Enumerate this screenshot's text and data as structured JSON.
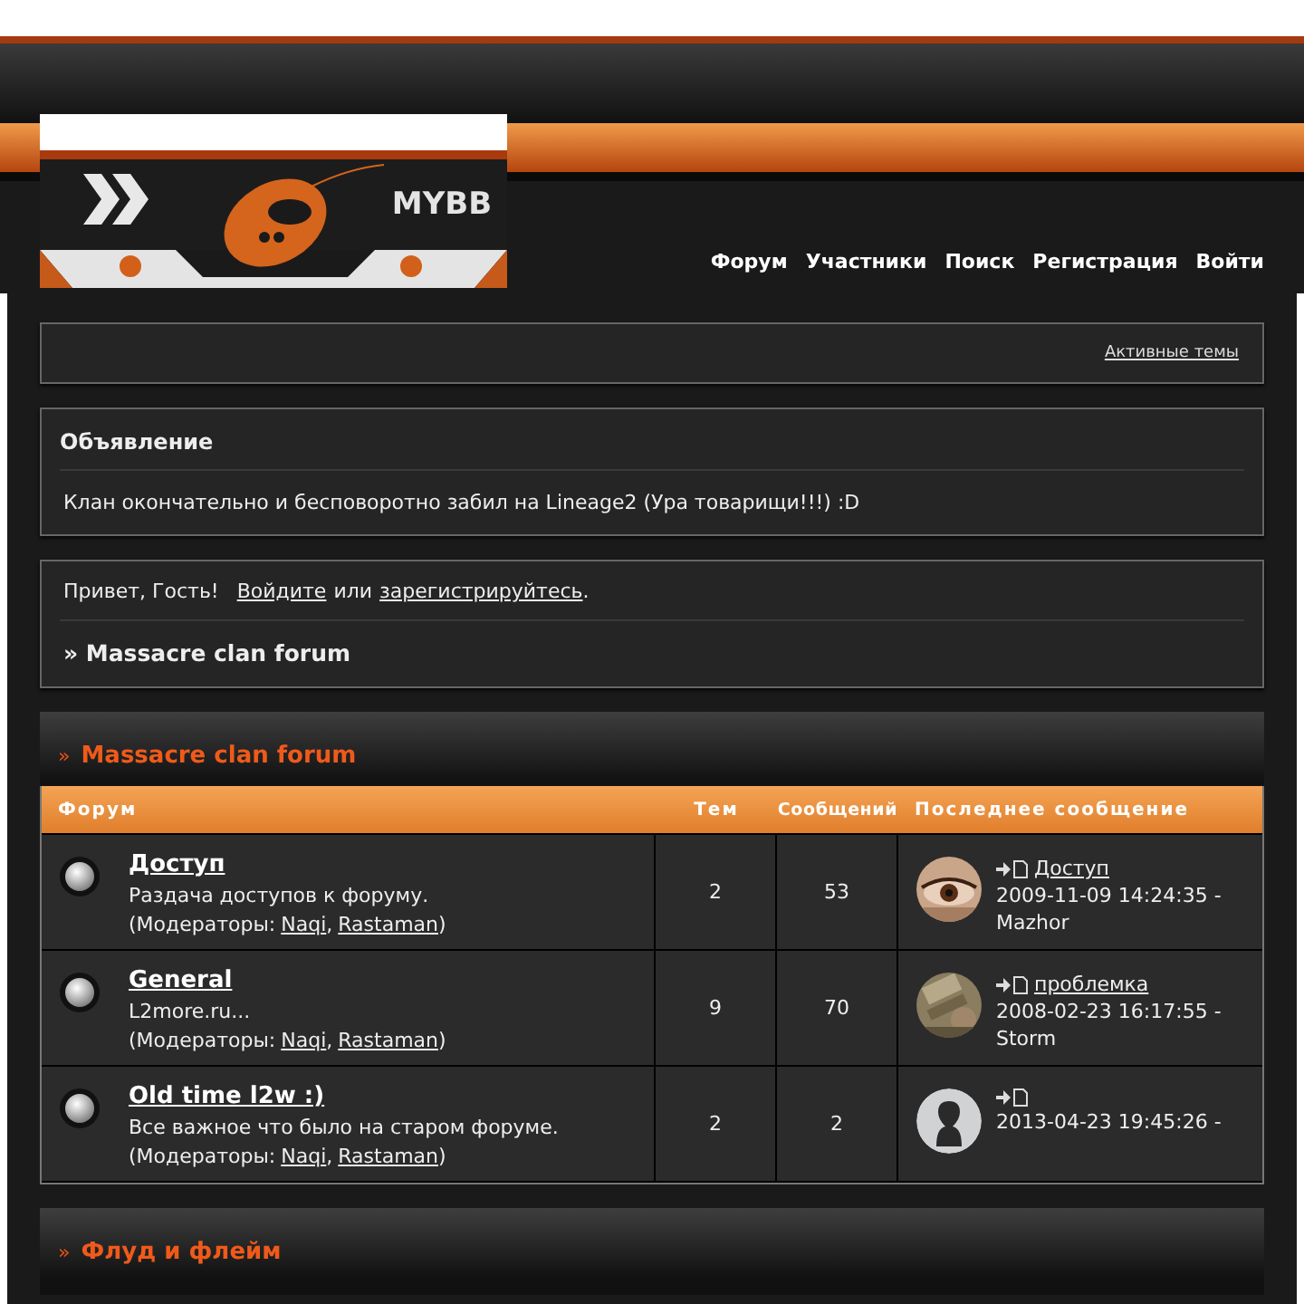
{
  "logo": {
    "text": "MYBB"
  },
  "nav": [
    "Форум",
    "Участники",
    "Поиск",
    "Регистрация",
    "Войти"
  ],
  "active_topics": "Активные темы",
  "announcement": {
    "title": "Объявление",
    "text": "Клан окончательно и бесповоротно забил на Lineage2 (Ура товарищи!!!) :D"
  },
  "welcome": {
    "greeting": "Привет, Гость!",
    "login": "Войдите",
    "or": "или",
    "register": "зарегистрируйтесь",
    "end": ".",
    "crumb": "» Massacre clan forum"
  },
  "categories": [
    {
      "marker": "»",
      "title": "Massacre clan forum",
      "columns": [
        "Форум",
        "Тем",
        "Сообщений",
        "Последнее сообщение"
      ],
      "rows": [
        {
          "name": "Доступ",
          "description": "Раздача доступов к форуму.",
          "moderators_label": "(Модераторы:",
          "moderators": [
            {
              "name": "Naqi",
              "after": ","
            },
            {
              "name": "Rastaman",
              "after": ")"
            }
          ],
          "topics": "2",
          "posts": "53",
          "last": {
            "kind": "picture",
            "title": "Доступ",
            "date": "2009-11-09 14:24:35 -",
            "author": "Mazhor"
          }
        },
        {
          "name": "General",
          "description": "L2more.ru...",
          "moderators_label": "(Модераторы:",
          "moderators": [
            {
              "name": "Naqi",
              "after": ","
            },
            {
              "name": "Rastaman",
              "after": ")"
            }
          ],
          "topics": "9",
          "posts": "70",
          "last": {
            "kind": "picture",
            "title": "проблемка",
            "date": "2008-02-23 16:17:55 -",
            "author": "Storm"
          }
        },
        {
          "name": "Old time l2w :)",
          "description": "Все важное что было на старом форуме.",
          "moderators_label": "(Модераторы:",
          "moderators": [
            {
              "name": "Naqi",
              "after": ","
            },
            {
              "name": "Rastaman",
              "after": ")"
            }
          ],
          "topics": "2",
          "posts": "2",
          "last": {
            "kind": "silhouette",
            "date": "2013-04-23 19:45:26 -"
          }
        }
      ]
    },
    {
      "marker": "»",
      "title": "Флуд и флейм"
    }
  ]
}
